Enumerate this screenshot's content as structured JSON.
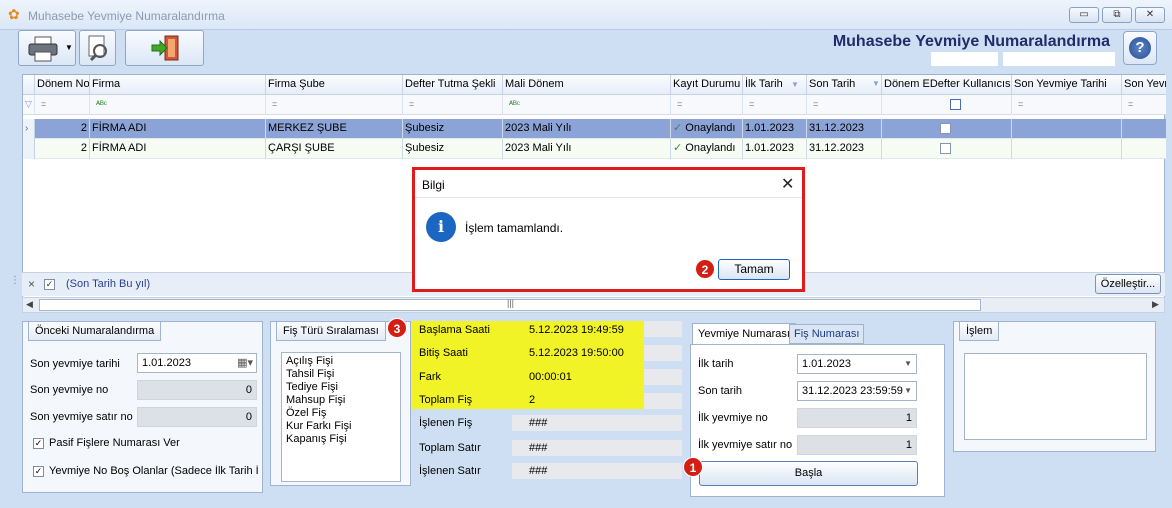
{
  "window": {
    "title": "Muhasebe Yevmiye Numaralandırma",
    "app_title": "Muhasebe Yevmiye Numaralandırma",
    "min": "▭",
    "restore": "⧉",
    "close": "✕"
  },
  "grid": {
    "columns": [
      "Dönem No",
      "Firma",
      "Firma Şube",
      "Defter Tutma Şekli",
      "Mali Dönem",
      "Kayıt Durumu",
      "İlk Tarih",
      "Son Tarih",
      "Dönem EDefter Kullanıcısı",
      "Son Yevmiye Tarihi",
      "Son Yevm"
    ],
    "filter_row": [
      "=",
      "ᴬᴮᶜ",
      "=",
      "=",
      "ᴬᴮᶜ",
      "=",
      "=",
      "=",
      "",
      "=",
      "="
    ],
    "rows": [
      {
        "donem": "2",
        "firma": "FİRMA ADI",
        "sube": "MERKEZ ŞUBE",
        "defter": "Şubesiz",
        "mali": "2023 Mali Yılı",
        "durum": "Onaylandı",
        "ilk": "1.01.2023",
        "son": "31.12.2023"
      },
      {
        "donem": "2",
        "firma": "FİRMA ADI",
        "sube": "ÇARŞI ŞUBE",
        "defter": "Şubesiz",
        "mali": "2023 Mali Yılı",
        "durum": "Onaylandı",
        "ilk": "1.01.2023",
        "son": "31.12.2023"
      }
    ],
    "filter_text": "(Son Tarih Bu yıl)",
    "customize": "Özelleştir..."
  },
  "dialog": {
    "title": "Bilgi",
    "message": "İşlem tamamlandı.",
    "ok": "Tamam",
    "badge": "2"
  },
  "onceki": {
    "title": "Önceki Numaralandırma",
    "son_tarih_label": "Son yevmiye tarihi",
    "son_tarih": "1.01.2023",
    "son_no_label": "Son yevmiye no",
    "son_no": "0",
    "son_satir_label": "Son yevmiye satır no",
    "son_satir": "0",
    "chk1": "Pasif Fişlere Numarası Ver",
    "chk2": "Yevmiye No Boş Olanlar (Sadece İlk Tarih İç"
  },
  "fis": {
    "title": "Fiş Türü Sıralaması",
    "items": [
      "Açılış Fişi",
      "Tahsil Fişi",
      "Tediye Fişi",
      "Mahsup Fişi",
      "Özel Fiş",
      "Kur Farkı Fişi",
      "Kapanış Fişi"
    ]
  },
  "stats": {
    "badge": "3",
    "rows": [
      {
        "label": "Başlama Saati",
        "value": "5.12.2023 19:49:59"
      },
      {
        "label": "Bitiş Saati",
        "value": "5.12.2023 19:50:00"
      },
      {
        "label": "Fark",
        "value": "00:00:01"
      },
      {
        "label": "Toplam Fiş",
        "value": "2"
      },
      {
        "label": "İşlenen Fiş",
        "value": "###"
      },
      {
        "label": "Toplam Satır",
        "value": "###"
      },
      {
        "label": "İşlenen Satır",
        "value": "###"
      }
    ]
  },
  "yevmiye": {
    "tab1": "Yevmiye Numarası",
    "tab2": "Fiş Numarası",
    "ilk_label": "İlk tarih",
    "ilk": "1.01.2023",
    "son_label": "Son tarih",
    "son": "31.12.2023 23:59:59",
    "ilk_no_label": "İlk yevmiye no",
    "ilk_no": "1",
    "ilk_satir_label": "İlk yevmiye satır no",
    "ilk_satir": "1",
    "start": "Başla",
    "badge": "1"
  },
  "islem": {
    "title": "İşlem"
  }
}
